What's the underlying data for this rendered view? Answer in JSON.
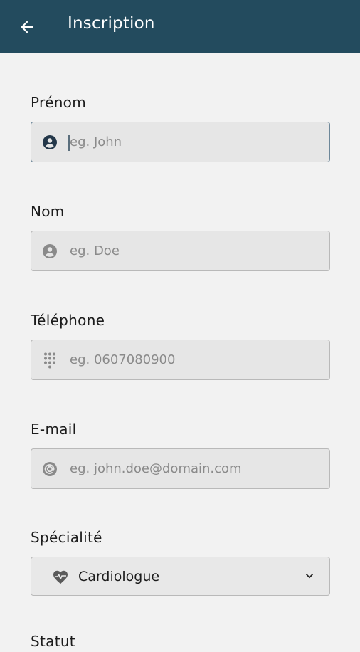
{
  "appbar": {
    "title": "Inscription",
    "back_icon": "arrow-left-icon",
    "color": "#234b5e"
  },
  "form": {
    "first_name": {
      "label": "Prénom",
      "placeholder": "eg. John",
      "icon": "account-circle-icon"
    },
    "last_name": {
      "label": "Nom",
      "placeholder": "eg. Doe",
      "icon": "account-circle-icon"
    },
    "phone": {
      "label": "Téléphone",
      "placeholder": "eg. 0607080900",
      "icon": "dialpad-icon"
    },
    "email": {
      "label": "E-mail",
      "placeholder": "eg. john.doe@domain.com",
      "icon": "at-sign-icon"
    },
    "specialty": {
      "label": "Spécialité",
      "value": "Cardiologue",
      "icon": "heart-pulse-icon"
    },
    "next_label": "Statut"
  }
}
